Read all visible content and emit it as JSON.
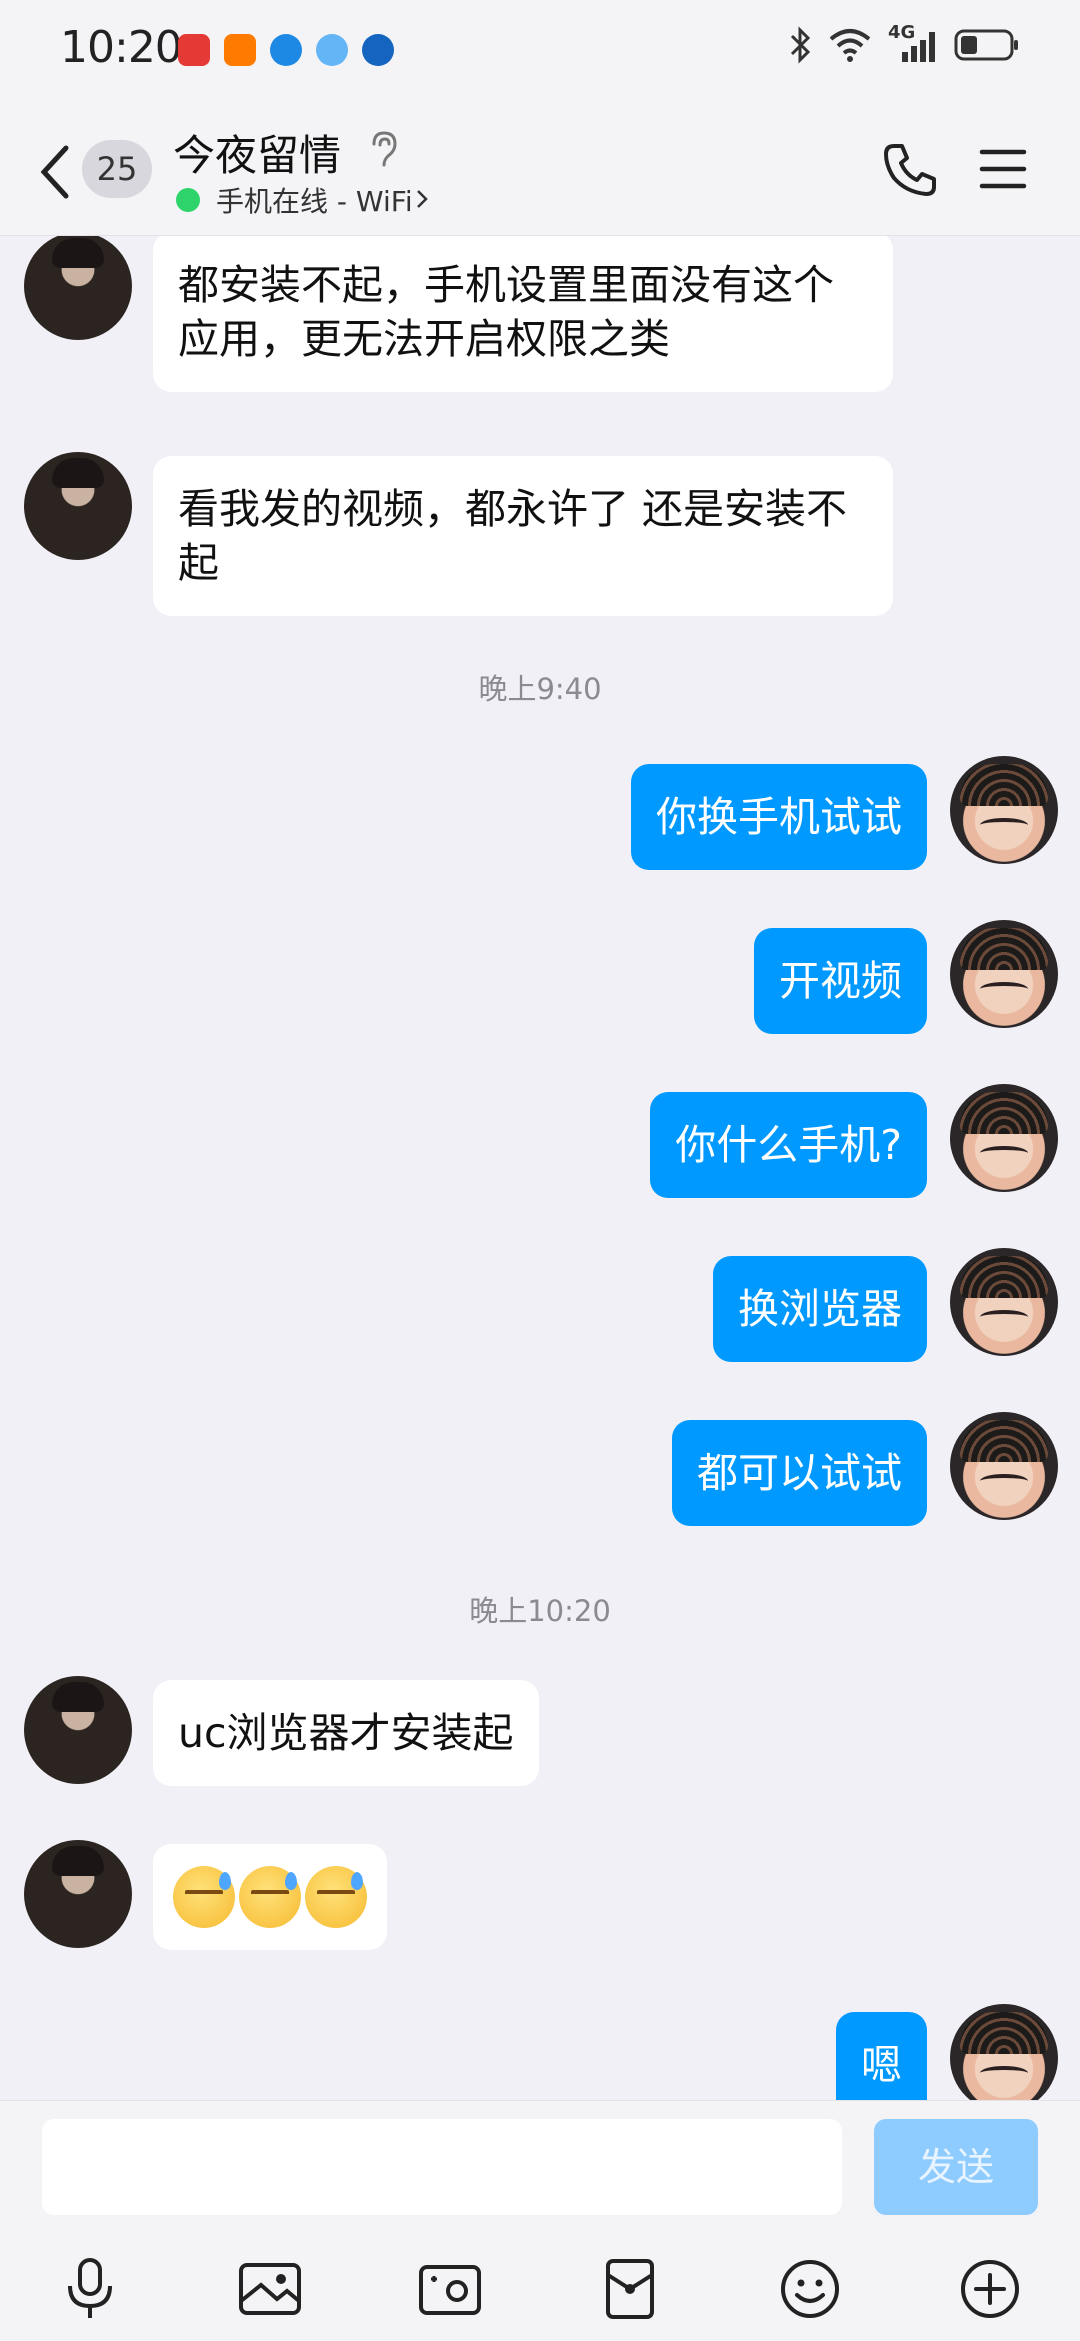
{
  "status_bar": {
    "time": "10:20",
    "app_icon_colors": [
      "#e53935",
      "#ff7a00",
      "#1e88e5",
      "#1e88e5",
      "#1565c0"
    ],
    "network_label": "4G"
  },
  "header": {
    "unread_count": "25",
    "title": "今夜留情",
    "subtitle": "手机在线 - WiFi",
    "online_color": "#2ed36b"
  },
  "messages": [
    {
      "side": "in",
      "text": "都安装不起，手机设置里面没有这个应用，更无法开启权限之类"
    },
    {
      "side": "in",
      "text": "看我发的视频，都永许了 还是安装不起"
    },
    {
      "type": "time",
      "text": "晚上9:40"
    },
    {
      "side": "out",
      "text": "你换手机试试"
    },
    {
      "side": "out",
      "text": "开视频"
    },
    {
      "side": "out",
      "text": "你什么手机?"
    },
    {
      "side": "out",
      "text": "换浏览器"
    },
    {
      "side": "out",
      "text": "都可以试试"
    },
    {
      "type": "time",
      "text": "晚上10:20"
    },
    {
      "side": "in",
      "text": "uc浏览器才安装起"
    },
    {
      "side": "in",
      "type": "emoji",
      "emoji": [
        "sweat-face",
        "sweat-face",
        "sweat-face"
      ]
    },
    {
      "side": "out",
      "text": "嗯"
    }
  ],
  "input": {
    "value": "",
    "send_label": "发送"
  },
  "colors": {
    "outgoing_bubble": "#0099ff",
    "send_disabled": "#8ecbff"
  }
}
